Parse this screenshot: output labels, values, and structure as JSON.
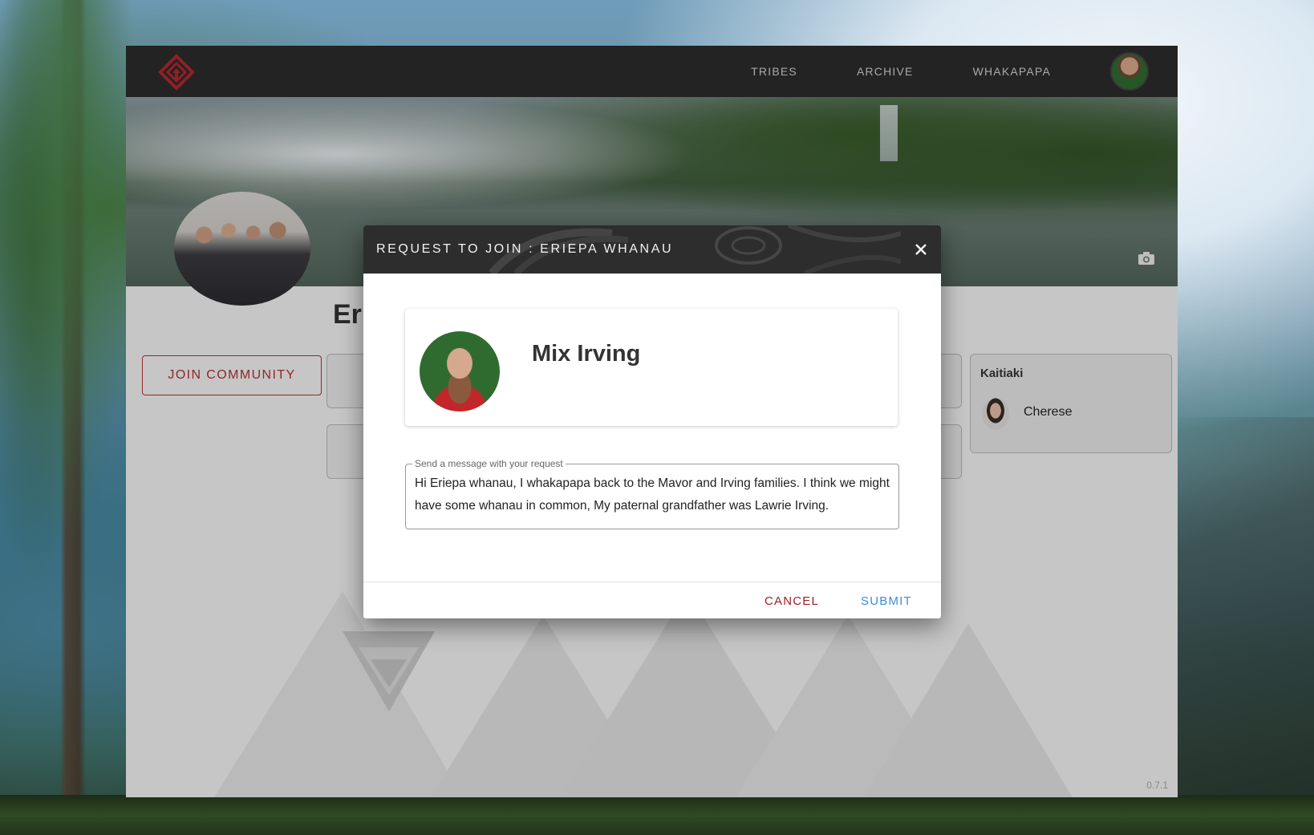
{
  "nav": {
    "links": [
      "TRIBES",
      "ARCHIVE",
      "WHAKAPAPA"
    ]
  },
  "group": {
    "title_visible": "Eri",
    "join_button": "JOIN COMMUNITY"
  },
  "kaitiaki": {
    "title": "Kaitiaki",
    "members": [
      "Cherese"
    ]
  },
  "dialog": {
    "title": "REQUEST TO JOIN : ERIEPA WHANAU",
    "profile_name": "Mix Irving",
    "message_label": "Send a message with your request",
    "message_value": "Hi Eriepa whanau, I whakapapa back to the Mavor and Irving families. I think we might have some whanau in common, My paternal grandfather was Lawrie Irving.",
    "cancel_label": "CANCEL",
    "submit_label": "SUBMIT"
  },
  "version": "0.7.1",
  "colors": {
    "accent_red": "#b23030",
    "cancel_red": "#a01e22",
    "submit_blue": "#3a8fd8",
    "header_dark": "#2b2b2b"
  },
  "icons": [
    "logo-icon",
    "camera-icon",
    "close-icon"
  ]
}
